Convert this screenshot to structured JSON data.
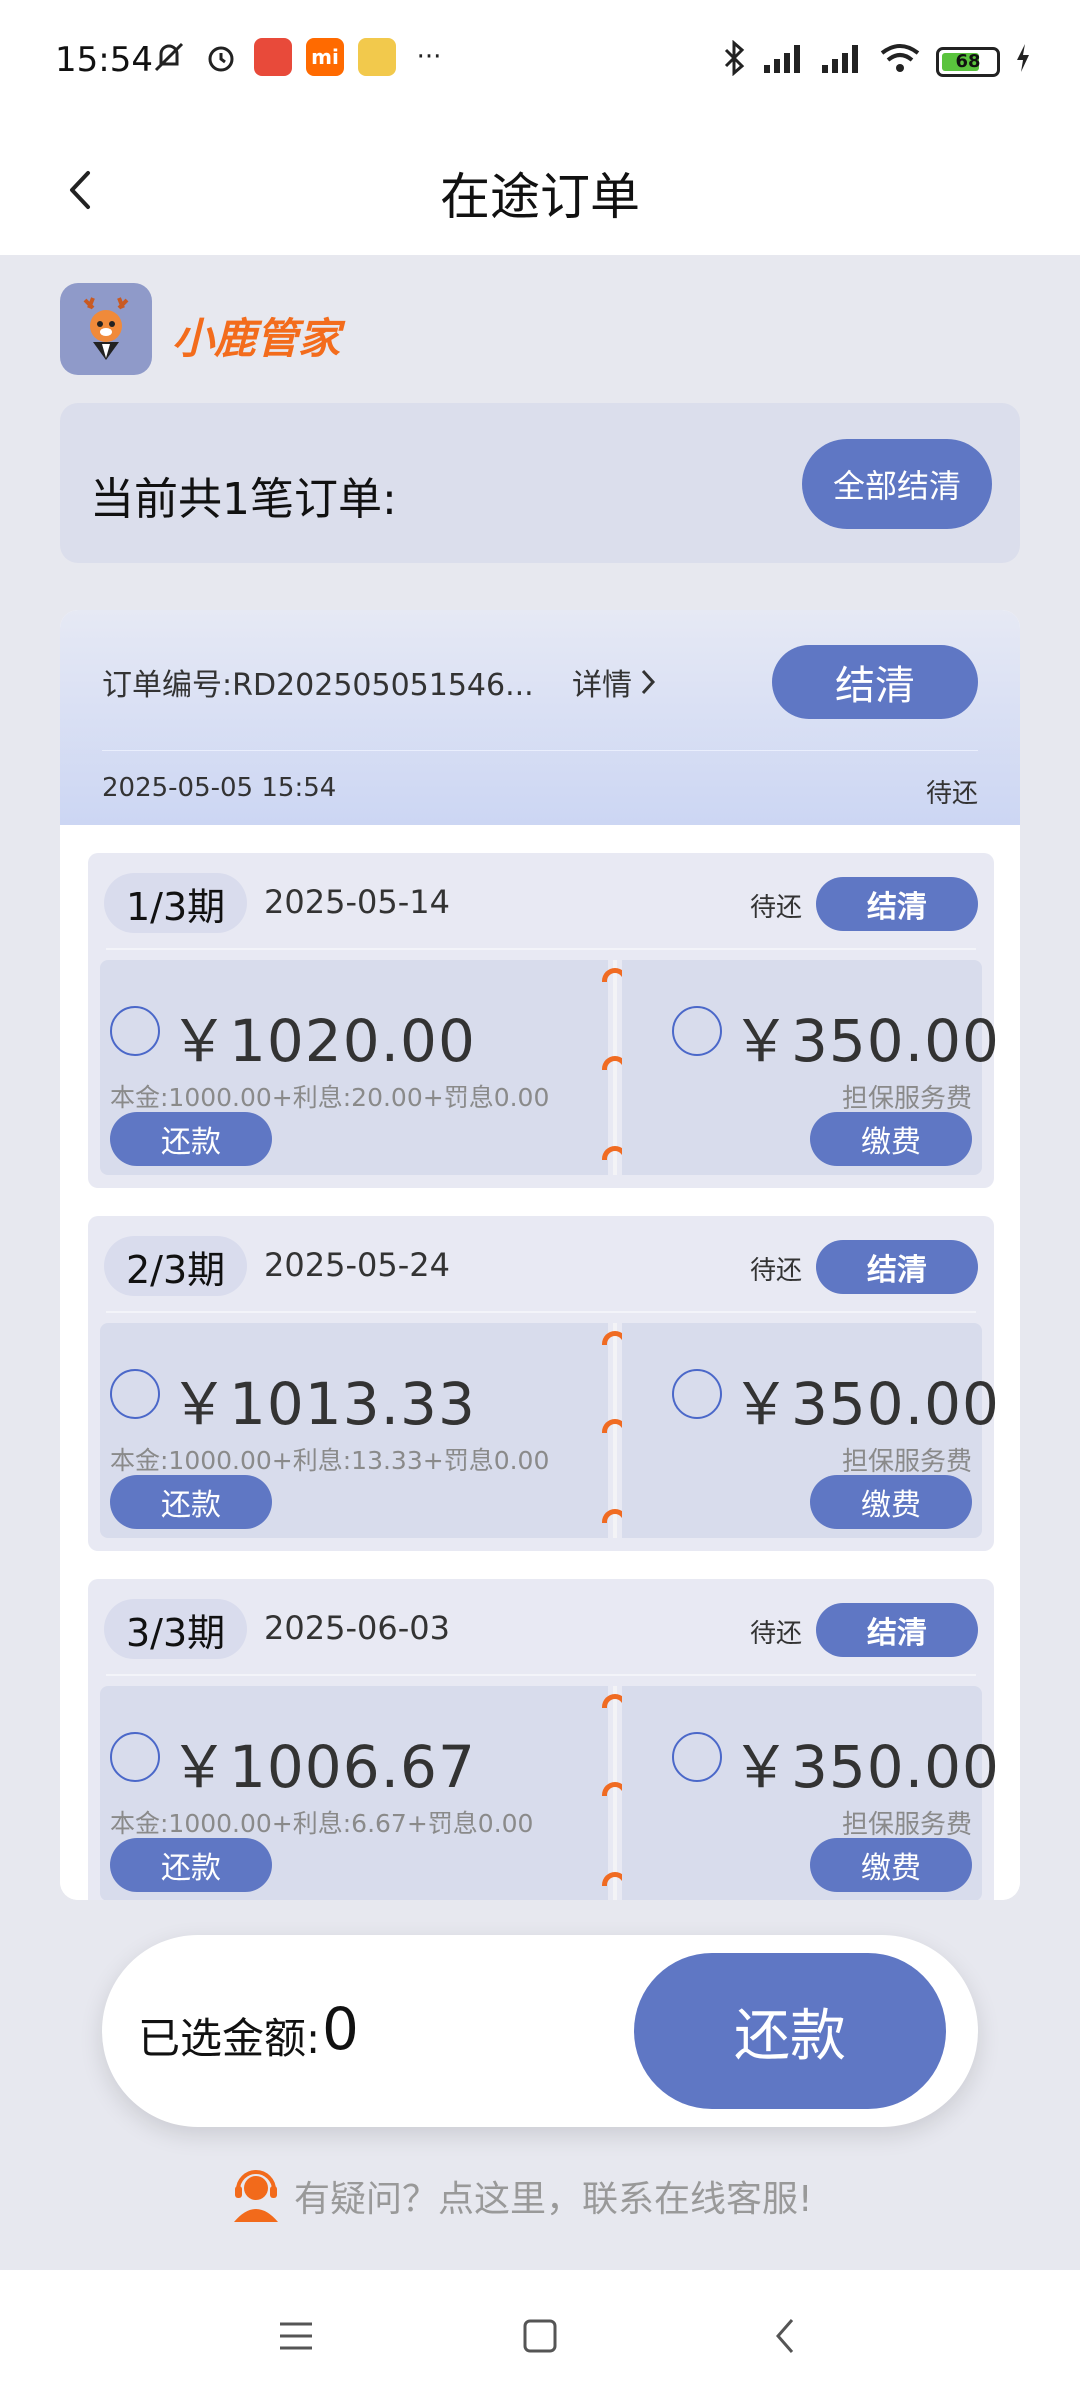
{
  "status_bar": {
    "time": "15:54",
    "battery": "68"
  },
  "header": {
    "title": "在途订单"
  },
  "brand": {
    "name": "小鹿管家"
  },
  "summary": {
    "text": "当前共1笔订单:",
    "settle_all_label": "全部结清"
  },
  "order": {
    "number_label": "订单编号:RD202505051546...",
    "detail_label": "详情",
    "settle_label": "结清",
    "time": "2025-05-05 15:54",
    "status": "待还",
    "installments": [
      {
        "period": "1/3期",
        "date": "2025-05-14",
        "status": "待还",
        "settle_label": "结清",
        "amount": "￥1020.00",
        "breakdown": "本金:1000.00+利息:20.00+罚息0.00",
        "repay_label": "还款",
        "fee_amount": "￥350.00",
        "fee_label": "担保服务费",
        "pay_label": "缴费"
      },
      {
        "period": "2/3期",
        "date": "2025-05-24",
        "status": "待还",
        "settle_label": "结清",
        "amount": "￥1013.33",
        "breakdown": "本金:1000.00+利息:13.33+罚息0.00",
        "repay_label": "还款",
        "fee_amount": "￥350.00",
        "fee_label": "担保服务费",
        "pay_label": "缴费"
      },
      {
        "period": "3/3期",
        "date": "2025-06-03",
        "status": "待还",
        "settle_label": "结清",
        "amount": "￥1006.67",
        "breakdown": "本金:1000.00+利息:6.67+罚息0.00",
        "repay_label": "还款",
        "fee_amount": "￥350.00",
        "fee_label": "担保服务费",
        "pay_label": "缴费"
      }
    ]
  },
  "paybar": {
    "selected_label": "已选金额:",
    "selected_value": "0",
    "repay_label": "还款"
  },
  "support": {
    "text": "有疑问？点这里，联系在线客服!"
  },
  "colors": {
    "accent": "#5f77c4",
    "brand_orange": "#f36c1c",
    "background": "#e7e8ef"
  }
}
